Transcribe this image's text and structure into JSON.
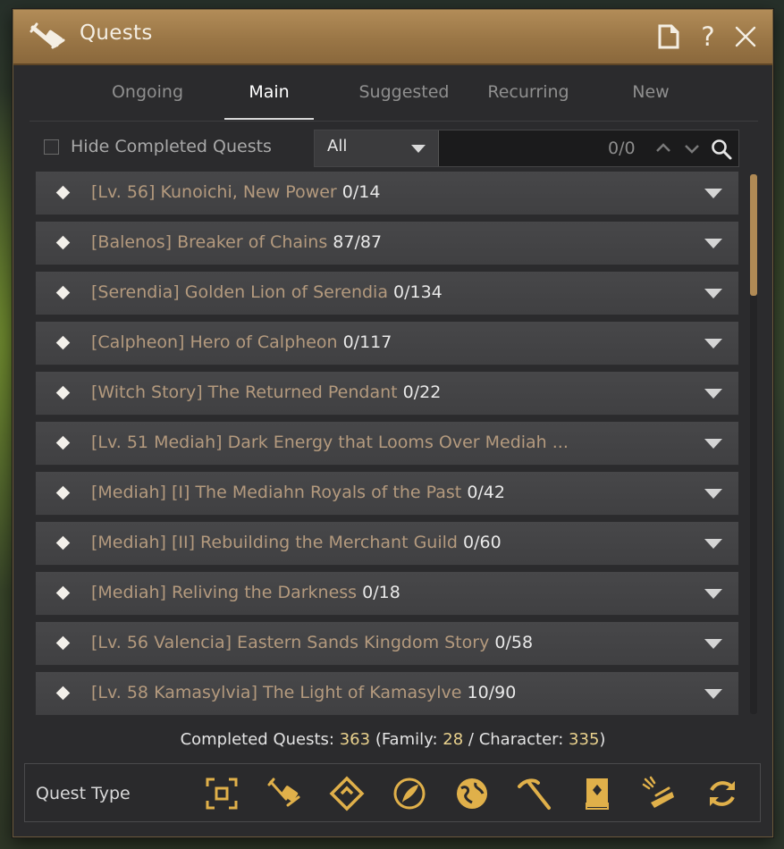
{
  "window": {
    "title": "Quests",
    "help_label": "?"
  },
  "tabs": [
    {
      "label": "Ongoing",
      "active": false
    },
    {
      "label": "Main",
      "active": true
    },
    {
      "label": "Suggested",
      "active": false
    },
    {
      "label": "Recurring",
      "active": false
    },
    {
      "label": "New",
      "active": false
    }
  ],
  "filter": {
    "hide_completed_label": "Hide Completed Quests",
    "hide_completed_checked": false,
    "select_value": "All",
    "result_count": "0/0"
  },
  "quests": [
    {
      "name": "[Lv. 56] Kunoichi, New Power",
      "progress": "0/14"
    },
    {
      "name": "[Balenos] Breaker of Chains",
      "progress": "87/87"
    },
    {
      "name": "[Serendia] Golden Lion of Serendia",
      "progress": "0/134"
    },
    {
      "name": "[Calpheon] Hero of Calpheon",
      "progress": "0/117"
    },
    {
      "name": "[Witch Story] The Returned Pendant",
      "progress": "0/22"
    },
    {
      "name": "[Lv. 51 Mediah] Dark Energy that Looms Over Mediah ...",
      "progress": ""
    },
    {
      "name": "[Mediah] [I] The Mediahn Royals of the Past",
      "progress": "0/42"
    },
    {
      "name": "[Mediah] [II] Rebuilding the Merchant Guild",
      "progress": "0/60"
    },
    {
      "name": "[Mediah] Reliving the Darkness",
      "progress": "0/18"
    },
    {
      "name": "[Lv. 56 Valencia] Eastern Sands Kingdom Story",
      "progress": "0/58"
    },
    {
      "name": "[Lv. 58 Kamasylvia] The Light of Kamasylve",
      "progress": "10/90"
    }
  ],
  "completed": {
    "label": "Completed Quests:",
    "total": "363",
    "family_label": "(Family:",
    "family": "28",
    "character_label": "/ Character:",
    "character": "335",
    "close_paren": ")"
  },
  "quest_type": {
    "label": "Quest Type",
    "icons": [
      "focus-icon",
      "combat-scroll-icon",
      "diamond-icon",
      "feather-icon",
      "globe-icon",
      "pickaxe-icon",
      "book-icon",
      "trade-icon",
      "refresh-icon"
    ]
  },
  "colors": {
    "title_bar": "#9a7646",
    "quest_name": "#b49a7e",
    "accent_gold": "#e0b04a",
    "number_highlight": "#e9d18d"
  }
}
